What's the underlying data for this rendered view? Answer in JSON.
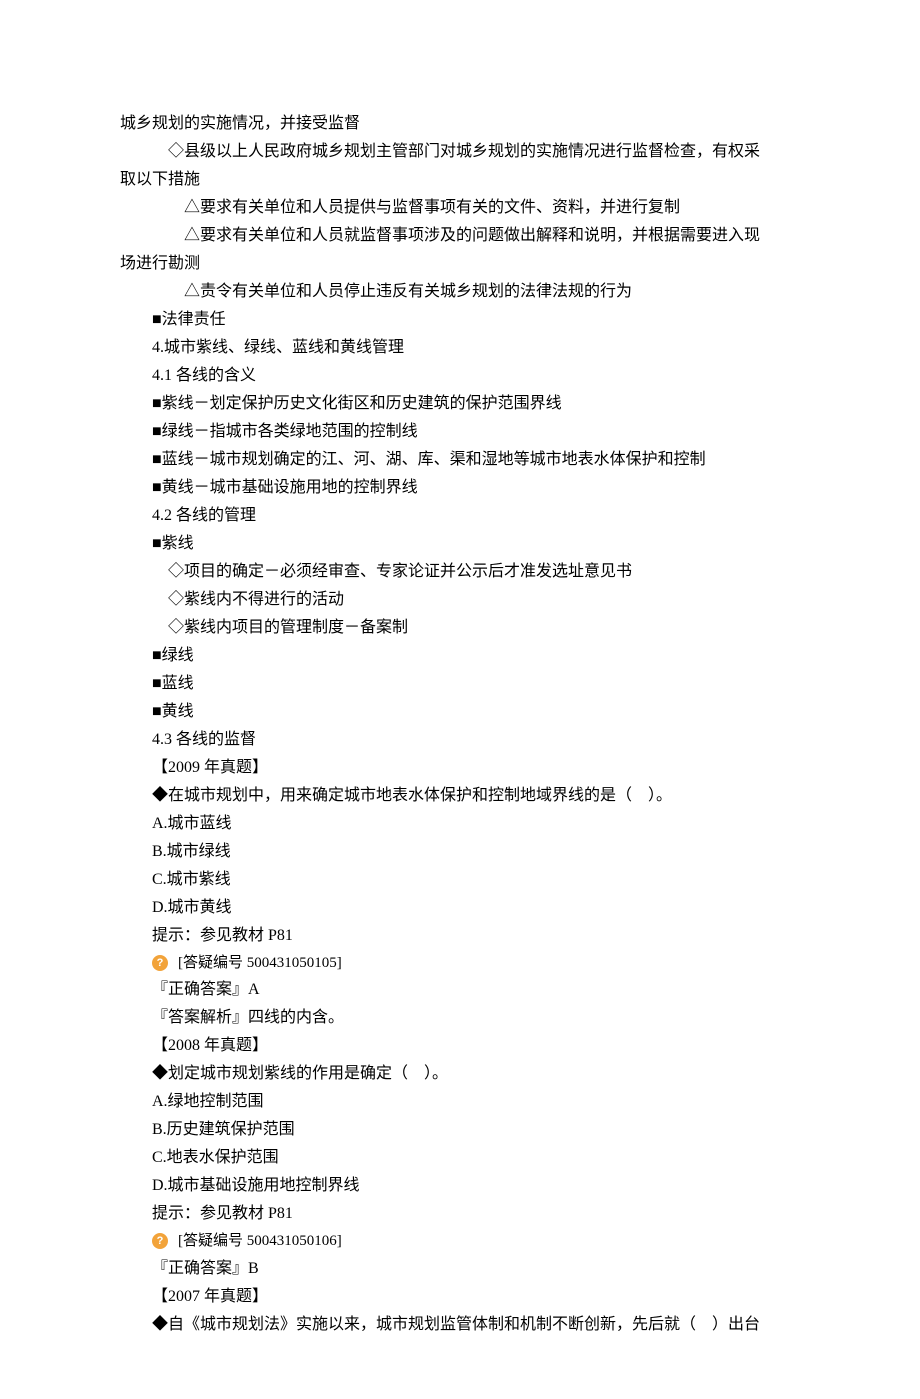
{
  "lines": [
    {
      "indent": "indent-0",
      "text": "城乡规划的实施情况，并接受监督"
    },
    {
      "indent": "indent-2",
      "text": "◇县级以上人民政府城乡规划主管部门对城乡规划的实施情况进行监督检查，有权采"
    },
    {
      "indent": "indent-0",
      "text": "取以下措施"
    },
    {
      "indent": "indent-3",
      "text": "△要求有关单位和人员提供与监督事项有关的文件、资料，并进行复制"
    },
    {
      "indent": "indent-3",
      "text": "△要求有关单位和人员就监督事项涉及的问题做出解释和说明，并根据需要进入现"
    },
    {
      "indent": "indent-0",
      "text": "场进行勘测"
    },
    {
      "indent": "indent-3",
      "text": "△责令有关单位和人员停止违反有关城乡规划的法律法规的行为"
    },
    {
      "indent": "indent-1",
      "text": "■法律责任"
    },
    {
      "indent": "indent-1",
      "text": "4.城市紫线、绿线、蓝线和黄线管理"
    },
    {
      "indent": "indent-1",
      "text": "4.1 各线的含义"
    },
    {
      "indent": "indent-1",
      "text": "■紫线－划定保护历史文化街区和历史建筑的保护范围界线"
    },
    {
      "indent": "indent-1",
      "text": "■绿线－指城市各类绿地范围的控制线"
    },
    {
      "indent": "indent-1",
      "text": "■蓝线－城市规划确定的江、河、湖、库、渠和湿地等城市地表水体保护和控制"
    },
    {
      "indent": "indent-1",
      "text": "■黄线－城市基础设施用地的控制界线"
    },
    {
      "indent": "indent-1",
      "text": "4.2 各线的管理"
    },
    {
      "indent": "indent-1",
      "text": "■紫线"
    },
    {
      "indent": "indent-2",
      "text": "◇项目的确定－必须经审查、专家论证并公示后才准发选址意见书"
    },
    {
      "indent": "indent-2",
      "text": "◇紫线内不得进行的活动"
    },
    {
      "indent": "indent-2",
      "text": "◇紫线内项目的管理制度－备案制"
    },
    {
      "indent": "indent-1",
      "text": "■绿线"
    },
    {
      "indent": "indent-1",
      "text": "■蓝线"
    },
    {
      "indent": "indent-1",
      "text": "■黄线"
    },
    {
      "indent": "indent-1",
      "text": "4.3 各线的监督"
    },
    {
      "indent": "indent-1",
      "text": "【2009 年真题】"
    },
    {
      "indent": "indent-1",
      "text": "◆在城市规划中，用来确定城市地表水体保护和控制地域界线的是（　）。"
    },
    {
      "indent": "indent-1",
      "text": "A.城市蓝线"
    },
    {
      "indent": "indent-1",
      "text": "B.城市绿线"
    },
    {
      "indent": "indent-1",
      "text": "C.城市紫线"
    },
    {
      "indent": "indent-1",
      "text": "D.城市黄线"
    },
    {
      "indent": "indent-1",
      "text": "提示：参见教材 P81"
    },
    {
      "indent": "indent-1",
      "icon": true,
      "text": "[答疑编号 500431050105]"
    },
    {
      "indent": "indent-1",
      "text": "『正确答案』A"
    },
    {
      "indent": "indent-1",
      "text": "『答案解析』四线的内含。"
    },
    {
      "indent": "indent-1",
      "text": "【2008 年真题】"
    },
    {
      "indent": "indent-1",
      "text": "◆划定城市规划紫线的作用是确定（　）。"
    },
    {
      "indent": "indent-1",
      "text": "A.绿地控制范围"
    },
    {
      "indent": "indent-1",
      "text": "B.历史建筑保护范围"
    },
    {
      "indent": "indent-1",
      "text": "C.地表水保护范围"
    },
    {
      "indent": "indent-1",
      "text": "D.城市基础设施用地控制界线"
    },
    {
      "indent": "indent-1",
      "text": "提示：参见教材 P81"
    },
    {
      "indent": "indent-1",
      "icon": true,
      "text": "[答疑编号 500431050106]"
    },
    {
      "indent": "indent-1",
      "text": "『正确答案』B"
    },
    {
      "indent": "indent-1",
      "text": "【2007 年真题】"
    },
    {
      "indent": "indent-1",
      "text": "◆自《城市规划法》实施以来，城市规划监管体制和机制不断创新，先后就（　）出台"
    }
  ],
  "icon_glyph": "?"
}
